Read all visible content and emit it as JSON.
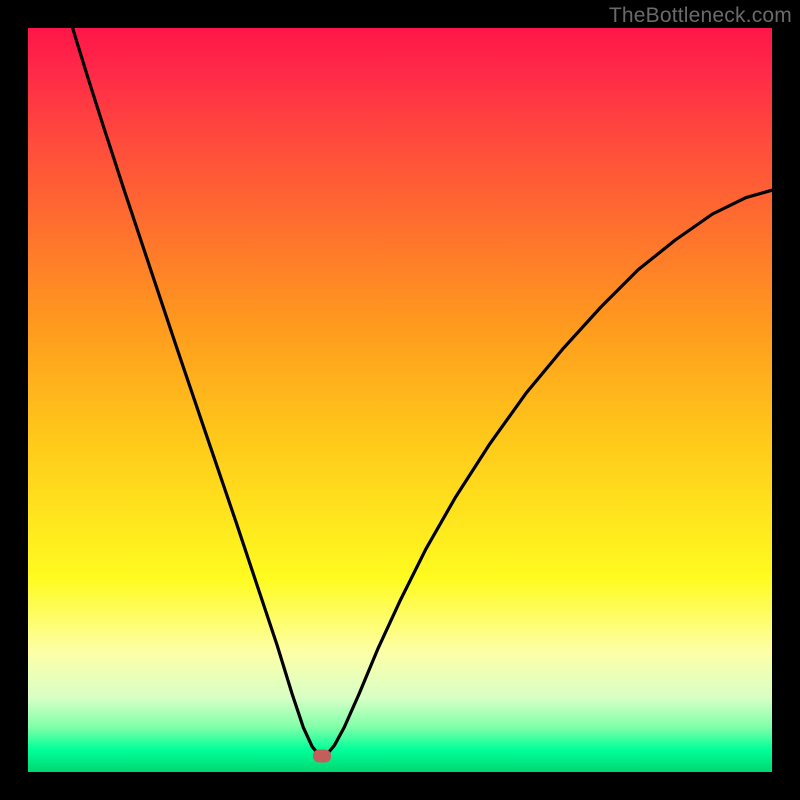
{
  "watermark": "TheBottleneck.com",
  "marker": {
    "x_frac": 0.395,
    "y_frac": 0.978
  },
  "chart_data": {
    "type": "line",
    "title": "",
    "xlabel": "",
    "ylabel": "",
    "xlim": [
      0,
      1
    ],
    "ylim": [
      0,
      1
    ],
    "note": "Bottleneck curve: normalized coordinates within the 744×744 plot frame (origin top-left, x→right, y→down). Minimum near x≈0.39 (mismatch ~0). Left branch rises steeply to y≈0 at x≈0.06; right branch rises more gradually to y≈0.22 at x=1.",
    "series": [
      {
        "name": "bottleneck-curve",
        "points": [
          {
            "x": 0.06,
            "y": 0.0
          },
          {
            "x": 0.08,
            "y": 0.065
          },
          {
            "x": 0.1,
            "y": 0.128
          },
          {
            "x": 0.13,
            "y": 0.22
          },
          {
            "x": 0.16,
            "y": 0.31
          },
          {
            "x": 0.2,
            "y": 0.43
          },
          {
            "x": 0.24,
            "y": 0.548
          },
          {
            "x": 0.28,
            "y": 0.665
          },
          {
            "x": 0.31,
            "y": 0.755
          },
          {
            "x": 0.335,
            "y": 0.83
          },
          {
            "x": 0.355,
            "y": 0.895
          },
          {
            "x": 0.37,
            "y": 0.94
          },
          {
            "x": 0.382,
            "y": 0.966
          },
          {
            "x": 0.392,
            "y": 0.978
          },
          {
            "x": 0.402,
            "y": 0.976
          },
          {
            "x": 0.412,
            "y": 0.964
          },
          {
            "x": 0.425,
            "y": 0.94
          },
          {
            "x": 0.445,
            "y": 0.895
          },
          {
            "x": 0.47,
            "y": 0.835
          },
          {
            "x": 0.5,
            "y": 0.77
          },
          {
            "x": 0.535,
            "y": 0.7
          },
          {
            "x": 0.575,
            "y": 0.63
          },
          {
            "x": 0.62,
            "y": 0.56
          },
          {
            "x": 0.67,
            "y": 0.49
          },
          {
            "x": 0.72,
            "y": 0.43
          },
          {
            "x": 0.77,
            "y": 0.375
          },
          {
            "x": 0.82,
            "y": 0.325
          },
          {
            "x": 0.87,
            "y": 0.285
          },
          {
            "x": 0.92,
            "y": 0.25
          },
          {
            "x": 0.965,
            "y": 0.228
          },
          {
            "x": 1.0,
            "y": 0.218
          }
        ]
      }
    ]
  }
}
